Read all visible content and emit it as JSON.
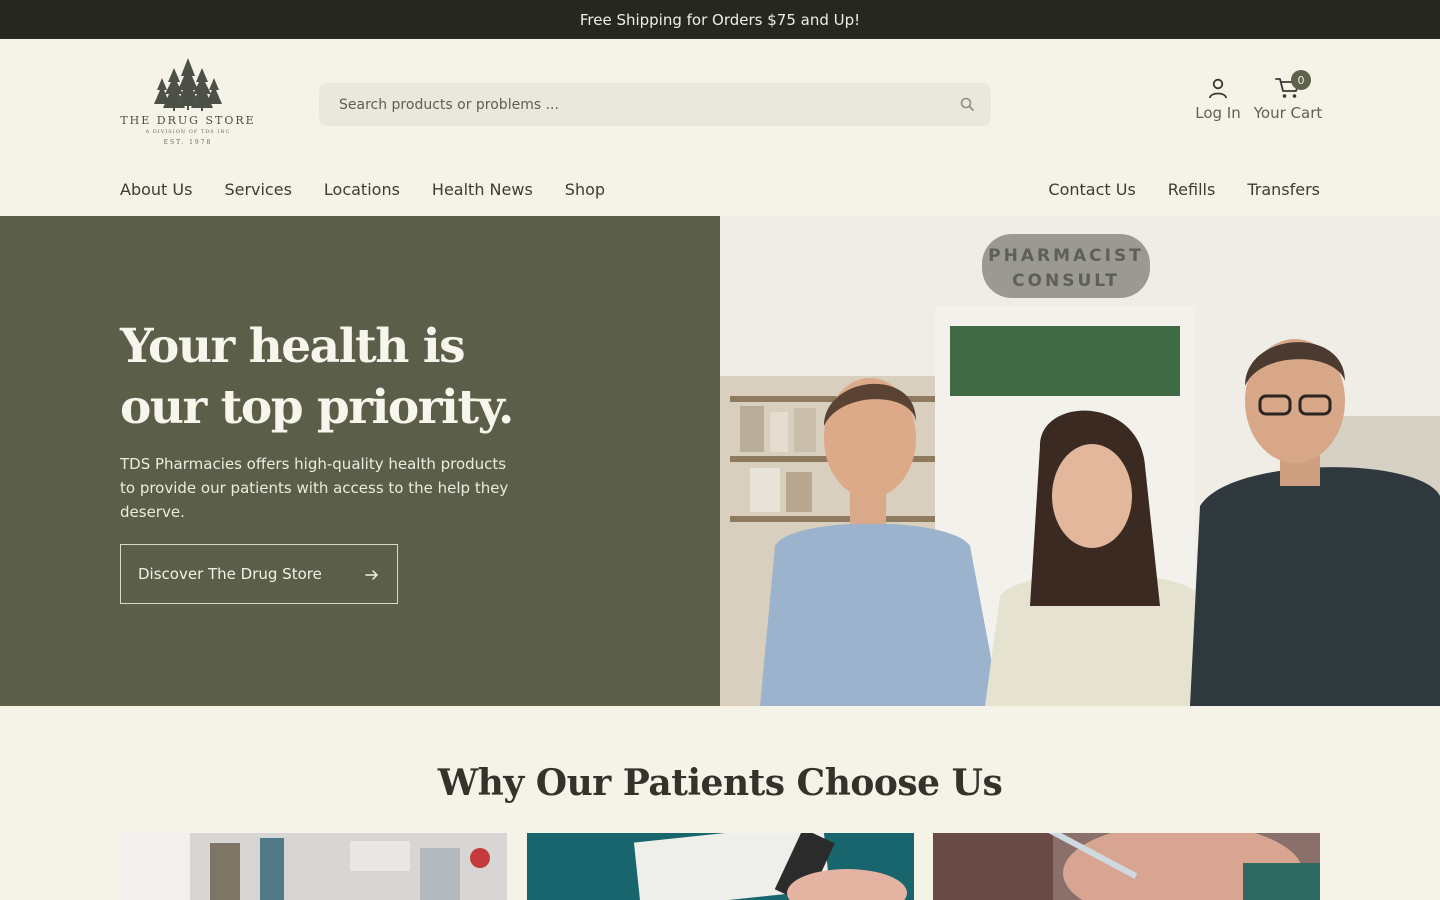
{
  "announcement": "Free Shipping for Orders $75 and Up!",
  "logo": {
    "name": "THE DRUG STORE",
    "subtitle": "A DIVISION OF TDS INC",
    "established": "EST. 1978"
  },
  "search": {
    "placeholder": "Search products or problems ..."
  },
  "account": {
    "login_label": "Log In",
    "cart_label": "Your Cart",
    "cart_count": "0"
  },
  "nav": {
    "left": [
      "About Us",
      "Services",
      "Locations",
      "Health News",
      "Shop"
    ],
    "right": [
      "Contact Us",
      "Refills",
      "Transfers"
    ]
  },
  "hero": {
    "title": "Your health is our top priority.",
    "text": "TDS Pharmacies offers high-quality health products to provide our patients with access to the help they deserve.",
    "button_label": "Discover The Drug Store",
    "sign_line1": "PHARMACIST",
    "sign_line2": "CONSULT"
  },
  "why": {
    "title": "Why Our Patients Choose Us"
  },
  "colors": {
    "announcement_bg": "#26271f",
    "page_bg": "#f5f3e8",
    "hero_bg": "#5b5f4a",
    "accent": "#5d624c"
  }
}
